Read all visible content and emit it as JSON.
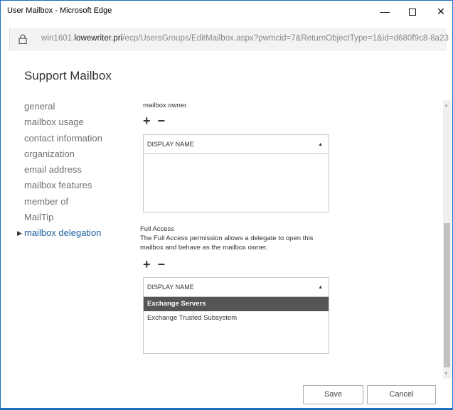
{
  "window": {
    "title": "User Mailbox - Microsoft Edge",
    "minimize_glyph": "—",
    "close_glyph": "✕"
  },
  "address": {
    "url_prefix": "win1601.",
    "url_domain": "lowewriter.pri",
    "url_path": "/ecp/UsersGroups/EditMailbox.aspx?pwmcid=7&ReturnObjectType=1&id=d680f9c8-8a23"
  },
  "page": {
    "title": "Support Mailbox"
  },
  "nav": {
    "items": [
      {
        "label": "general"
      },
      {
        "label": "mailbox usage"
      },
      {
        "label": "contact information"
      },
      {
        "label": "organization"
      },
      {
        "label": "email address"
      },
      {
        "label": "mailbox features"
      },
      {
        "label": "member of"
      },
      {
        "label": "MailTip"
      },
      {
        "label": "mailbox delegation"
      }
    ],
    "active_index": 8,
    "active_marker": "▶"
  },
  "send_on_behalf": {
    "description_tail": "mailbox owner.",
    "add_glyph": "+",
    "remove_glyph": "−",
    "column_header": "DISPLAY NAME",
    "sort_glyph": "▲",
    "rows": []
  },
  "full_access": {
    "heading": "Full Access",
    "description": "The Full Access permission allows a delegate to open this mailbox and behave as the mailbox owner.",
    "add_glyph": "+",
    "remove_glyph": "−",
    "column_header": "DISPLAY NAME",
    "sort_glyph": "▲",
    "rows": [
      {
        "name": "Exchange Servers",
        "selected": true
      },
      {
        "name": "Exchange Trusted Subsystem",
        "selected": false
      }
    ]
  },
  "scrollbar": {
    "up_glyph": "▲",
    "down_glyph": "▼"
  },
  "footer": {
    "save_label": "Save",
    "cancel_label": "Cancel"
  },
  "colors": {
    "accent": "#1e6fc0",
    "active_nav": "#1a5fa0",
    "selected_row": "#555555"
  }
}
